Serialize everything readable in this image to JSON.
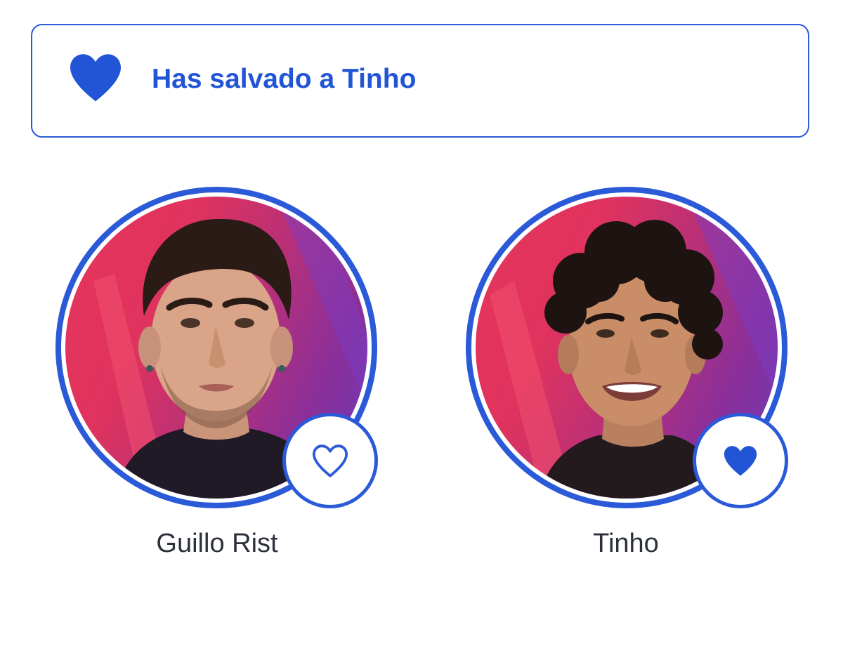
{
  "banner": {
    "message": "Has salvado a Tinho",
    "icon": "heart-filled-icon"
  },
  "candidates": [
    {
      "name": "Guillo Rist",
      "voted": false,
      "vote_icon": "heart-outline-icon"
    },
    {
      "name": "Tinho",
      "voted": true,
      "vote_icon": "heart-filled-icon"
    }
  ],
  "colors": {
    "accent": "#2b5ad8",
    "text": "#2b303a",
    "photo_bg_start": "#e5345a",
    "photo_bg_end": "#6a3bb8"
  }
}
